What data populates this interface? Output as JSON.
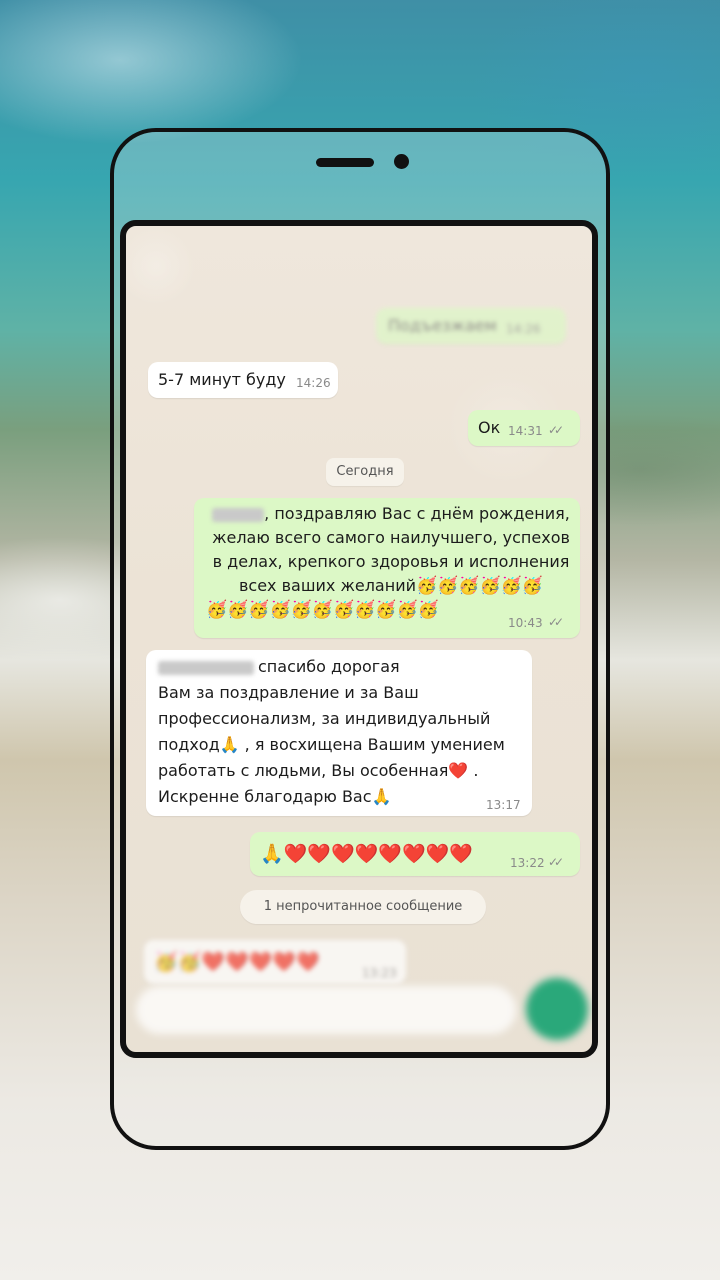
{
  "chat": {
    "top_blurred_message": {
      "text": "Подъезжаем",
      "time": "14:26"
    },
    "messages": [
      {
        "text": "5-7 минут буду",
        "time": "14:26"
      },
      {
        "text": "Ок",
        "time": "14:31",
        "status": "✓✓"
      }
    ],
    "date_divider": "Сегодня",
    "greeting": {
      "line1": ", поздравляю Вас с днём рождения,",
      "line2": "желаю всего самого наилучшего, успехов",
      "line3": "в делах, крепкого здоровья и исполнения",
      "line4": "всех ваших желаний",
      "emoji_line4": "🥳🥳🥳🥳🥳🥳",
      "emoji_line5": "🥳🥳🥳🥳🥳🥳🥳🥳🥳🥳🥳",
      "time": "10:43",
      "status": "✓✓"
    },
    "reply": {
      "line1": "спасибо дорогая",
      "line2": "Вам за поздравление и за Ваш",
      "line3": "профессионализм, за индивидуальный",
      "line4": "подход🙏 , я восхищена Вашим умением",
      "line5": "работать с людьми, Вы особенная❤️ .",
      "line6": "Искренне благодарю Вас🙏",
      "time": "13:17"
    },
    "hearts": {
      "text": "🙏❤️❤️❤️❤️❤️❤️❤️❤️",
      "time": "13:22",
      "status": "✓✓"
    },
    "unread_divider": "1 непрочитанное сообщение",
    "last": {
      "text": "🥳🥳❤️❤️❤️❤️❤️",
      "time": "13:23"
    }
  }
}
